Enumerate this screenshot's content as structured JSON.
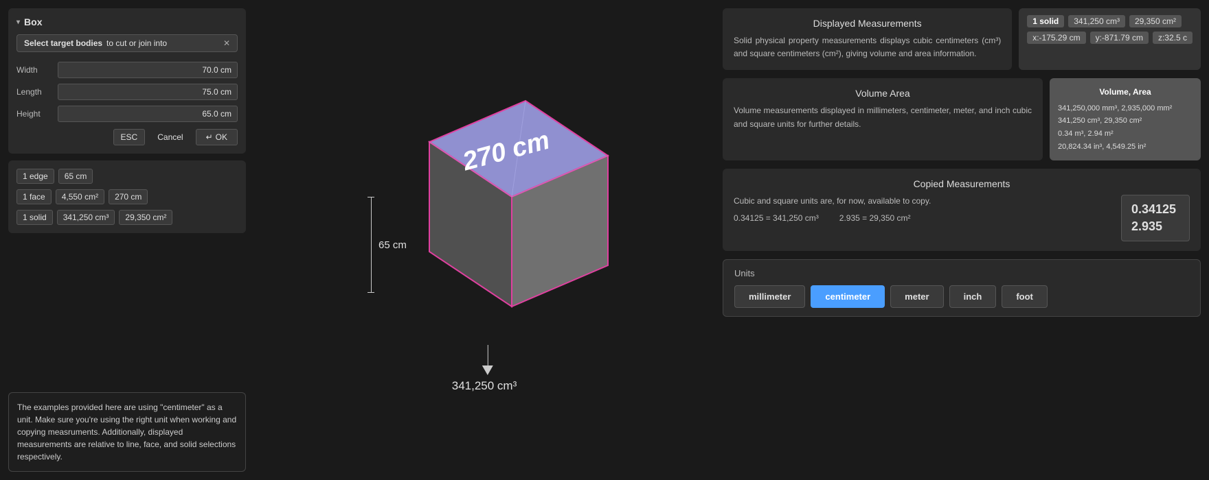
{
  "leftPanel": {
    "title": "Box",
    "chevron": "▾",
    "selectBtn": {
      "bold": "Select target bodies",
      "rest": " to cut or join into",
      "close": "✕"
    },
    "fields": [
      {
        "label": "Width",
        "value": "70.0 cm"
      },
      {
        "label": "Length",
        "value": "75.0 cm"
      },
      {
        "label": "Height",
        "value": "65.0 cm"
      }
    ],
    "buttons": {
      "esc": "ESC",
      "cancel": "Cancel",
      "enter": "↵",
      "ok": "OK"
    },
    "selection": [
      {
        "type": "1 edge",
        "values": [
          "65 cm"
        ]
      },
      {
        "type": "1 face",
        "values": [
          "4,550 cm²",
          "270 cm"
        ]
      },
      {
        "type": "1 solid",
        "values": [
          "341,250 cm³",
          "29,350 cm²"
        ]
      }
    ]
  },
  "note": "The examples provided here are using \"centimeter\" as a unit. Make sure you're using the right unit when working and copying measruments.  Additionally, displayed measurements are relative to line, face, and solid selections respectively.",
  "center": {
    "labelCm": "270 cm",
    "heightLabel": "65 cm",
    "volumeLabel": "341,250 cm³"
  },
  "rightPanel": {
    "displayedMeasurements": {
      "title": "Displayed Measurements",
      "body": "Solid physical property measurements displays cubic centimeters (cm³) and square centimeters (cm²), giving volume and area information."
    },
    "displayedSideCard": {
      "row1": {
        "bold": "1 solid",
        "values": [
          "341,250 cm³",
          "29,350 cm²"
        ]
      },
      "row2": {
        "values": [
          "x:-175.29 cm",
          "y:-871.79 cm",
          "z:32.5 c"
        ]
      }
    },
    "volumeArea": {
      "title": "Volume Area",
      "body": "Volume measurements displayed in millimeters, centimeter, meter, and inch cubic and square units for further details."
    },
    "volumeSideCard": {
      "title": "Volume, Area",
      "lines": [
        "341,250,000 mm³, 2,935,000 mm²",
        "341,250 cm³, 29,350 cm²",
        "0.34 m³, 2.94 m²",
        "20,824.34 in³, 4,549.25 in²"
      ]
    },
    "copiedMeasurements": {
      "title": "Copied Measurements",
      "body": "Cubic and square units are, for now, available to copy.",
      "values": [
        "0.34125",
        "2.935"
      ],
      "eq1": "0.34125 = 341,250 cm³",
      "eq2": "2.935 = 29,350 cm²"
    },
    "units": {
      "label": "Units",
      "buttons": [
        {
          "label": "millimeter",
          "active": false
        },
        {
          "label": "centimeter",
          "active": true
        },
        {
          "label": "meter",
          "active": false
        },
        {
          "label": "inch",
          "active": false
        },
        {
          "label": "foot",
          "active": false
        }
      ]
    }
  }
}
